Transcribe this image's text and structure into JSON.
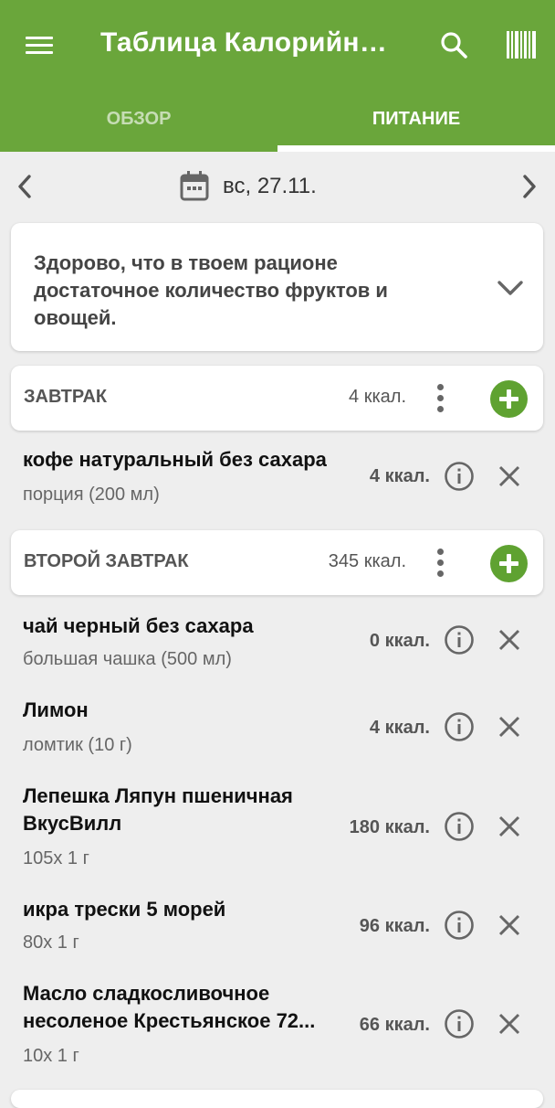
{
  "app": {
    "title": "Таблица Калорийности",
    "accent_color": "#6aa63b",
    "icons": {
      "menu": "menu-icon",
      "search": "search-icon",
      "barcode": "barcode-icon"
    }
  },
  "tabs": [
    {
      "label": "ОБЗОР",
      "active": false
    },
    {
      "label": "ПИТАНИЕ",
      "active": true
    }
  ],
  "datebar": {
    "date": "вс, 27.11.",
    "icons": {
      "prev": "chevron-left-icon",
      "calendar": "calendar-icon",
      "next": "chevron-right-icon"
    }
  },
  "tip": {
    "text": "Здорово, что в твоем рационе достаточное количество фруктов и овощей.",
    "icon": "chevron-down-icon"
  },
  "meals": [
    {
      "title": "ЗАВТРАК",
      "kcal": "4 ккал.",
      "items": [
        {
          "name": "кофе натуральный без сахара",
          "portion": "порция (200 мл)",
          "kcal": "4 ккал."
        }
      ]
    },
    {
      "title": "ВТОРОЙ ЗАВТРАК",
      "kcal": "345 ккал.",
      "items": [
        {
          "name": "чай черный без сахара",
          "portion": "большая чашка (500 мл)",
          "kcal": "0 ккал."
        },
        {
          "name": "Лимон",
          "portion": "ломтик (10 г)",
          "kcal": "4 ккал."
        },
        {
          "name": "Лепешка Ляпун пшеничная ВкусВилл",
          "portion": "105x 1 г",
          "kcal": "180 ккал."
        },
        {
          "name": "икра трески 5 морей",
          "portion": "80x 1 г",
          "kcal": "96 ккал."
        },
        {
          "name": "Масло сладкосливочное несоленое Крестьянское 72...",
          "portion": "10x 1 г",
          "kcal": "66 ккал."
        }
      ]
    }
  ]
}
